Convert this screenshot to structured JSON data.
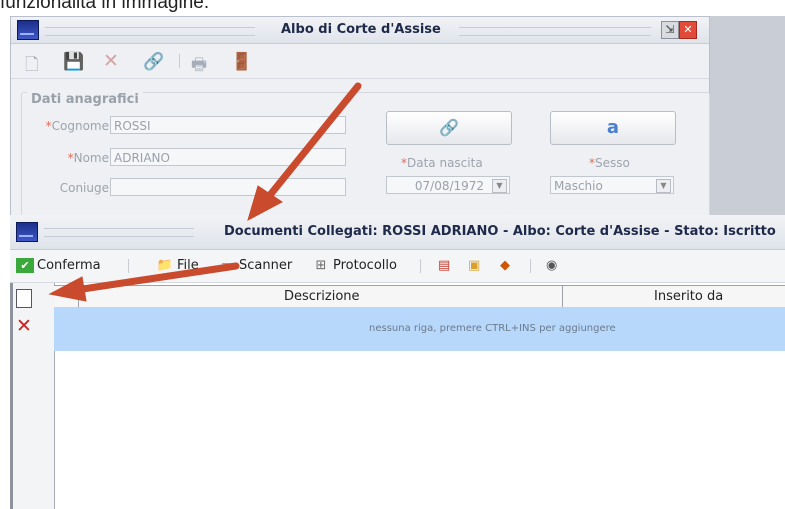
{
  "caption": "funzionalità in immagine.",
  "back_window": {
    "title": "Albo di Corte d'Assise",
    "min_glyph": "⇲",
    "close_glyph": "✕",
    "toolbar": {
      "icons": [
        "new-document-icon",
        "save-icon",
        "delete-icon",
        "link-icon",
        "print-icon",
        "door-icon"
      ]
    },
    "section": "Dati anagrafici",
    "fields": {
      "cognome": {
        "label": "Cognome",
        "value": "ROSSI"
      },
      "nome": {
        "label": "Nome",
        "value": "ADRIANO"
      },
      "coniuge": {
        "label": "Coniuge",
        "value": ""
      },
      "data_nascita": {
        "label": "Data nascita",
        "value": "07/08/1972"
      },
      "sesso": {
        "label": "Sesso",
        "value": "Maschio"
      }
    }
  },
  "front_window": {
    "title": "Documenti Collegati: ROSSI ADRIANO - Albo: Corte d'Assise - Stato: Iscritto",
    "toolbar": {
      "conferma": "Conferma",
      "file": "File",
      "scanner": "Scanner",
      "protocollo": "Protocollo"
    },
    "grid": {
      "columns": [
        "Descrizione",
        "Inserito da"
      ],
      "empty_message": "nessuna riga, premere CTRL+INS per aggiungere"
    }
  },
  "colors": {
    "arrow": "#c94a2c",
    "selection_row": "#b8d8fb",
    "close_red": "#e24a3a"
  }
}
